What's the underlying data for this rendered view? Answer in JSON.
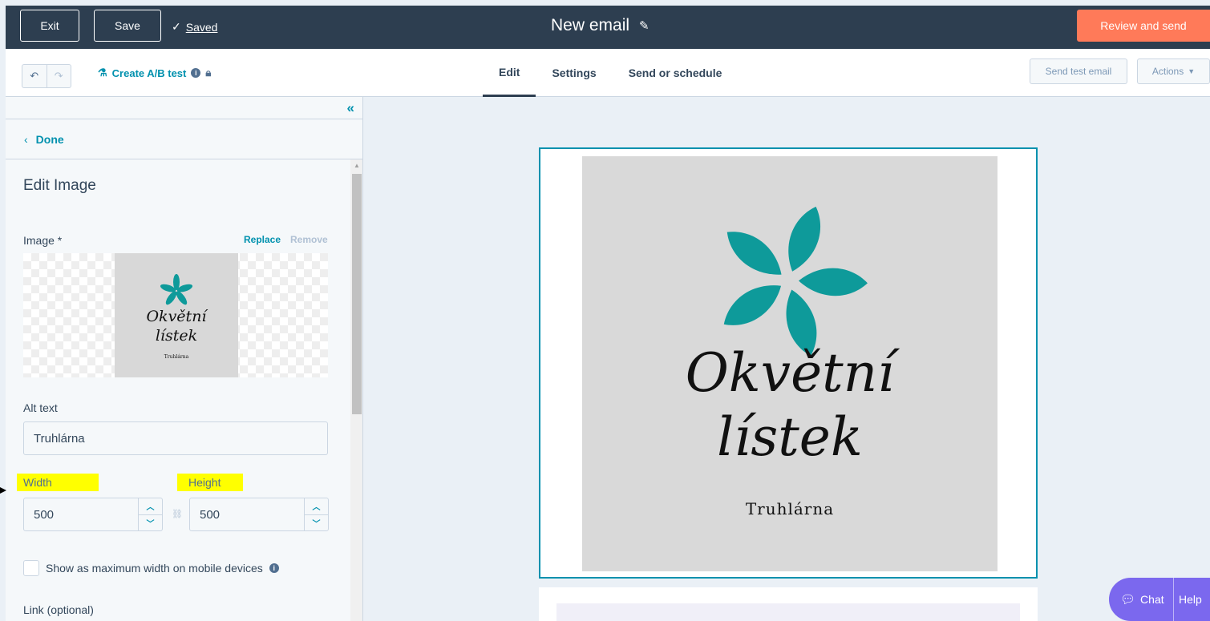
{
  "topbar": {
    "exit_label": "Exit",
    "save_label": "Save",
    "saved_label": "Saved",
    "title": "New email",
    "review_label": "Review and send"
  },
  "subbar": {
    "ab_test_label": "Create A/B test",
    "tabs": [
      {
        "label": "Edit",
        "active": true
      },
      {
        "label": "Settings",
        "active": false
      },
      {
        "label": "Send or schedule",
        "active": false
      }
    ],
    "send_test_label": "Send test email",
    "actions_label": "Actions"
  },
  "panel": {
    "done_label": "Done",
    "heading": "Edit Image",
    "image_label": "Image *",
    "replace_label": "Replace",
    "remove_label": "Remove",
    "alt_text_label": "Alt text",
    "alt_text_value": "Truhlárna",
    "width_label": "Width",
    "height_label": "Height",
    "width_value": "500",
    "height_value": "500",
    "mobile_checkbox_label": "Show as maximum width on mobile devices",
    "mobile_checkbox_checked": false,
    "link_label": "Link (optional)"
  },
  "logo": {
    "line1": "Okvětní",
    "line2": "lístek",
    "tagline": "Truhlárna"
  },
  "chat": {
    "chat_label": "Chat",
    "help_label": "Help"
  },
  "colors": {
    "topbar_bg": "#2d3e50",
    "accent": "#0091ae",
    "cta": "#ff7a59",
    "flower": "#0e9a9a",
    "highlight": "#ffff00",
    "chat": "#7b68ee"
  }
}
